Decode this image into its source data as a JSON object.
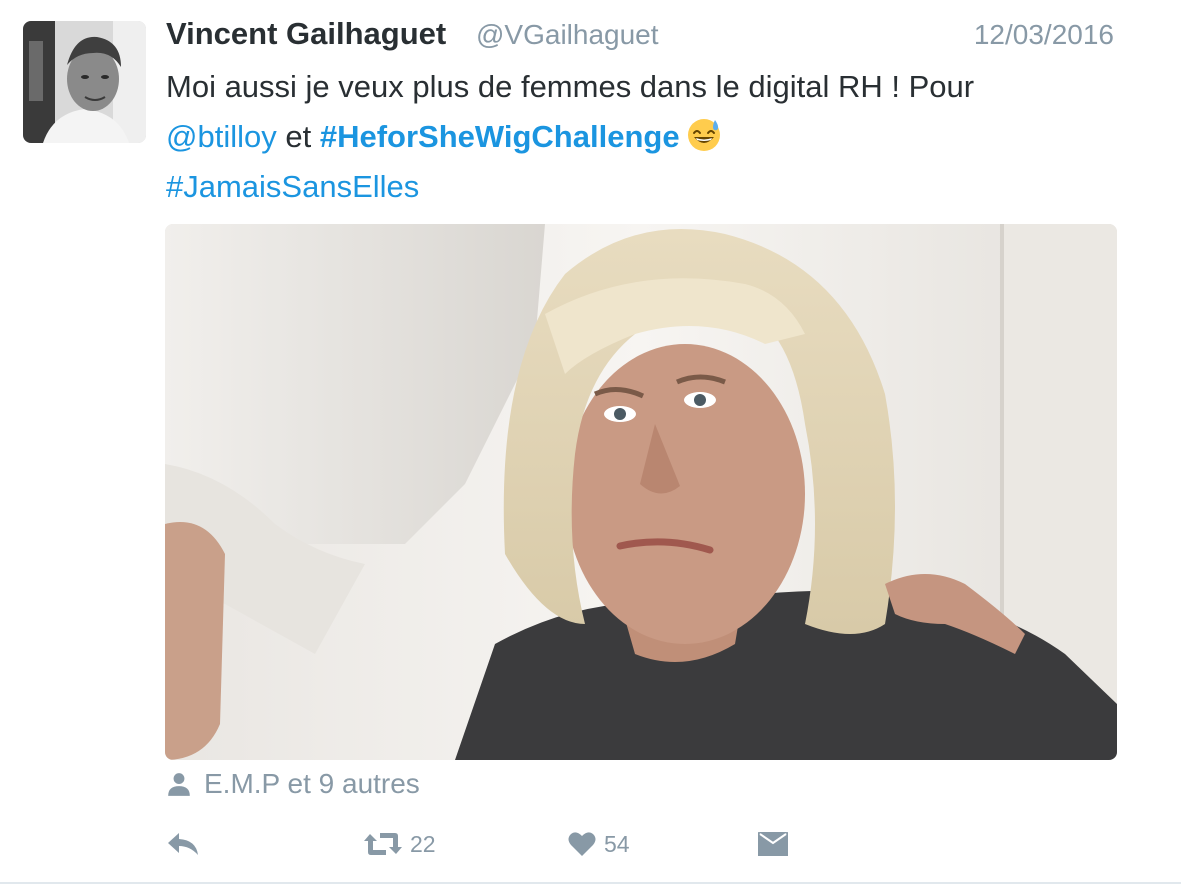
{
  "tweet": {
    "author": {
      "name": "Vincent Gailhaguet",
      "handle": "@VGailhaguet",
      "avatar_description": "avatar"
    },
    "date": "12/03/2016",
    "text": {
      "line1": "Moi aussi je veux plus de femmes dans le digital RH ! Pour",
      "mention": "@btilloy",
      "connector": "et",
      "hashtag1": "#HeforSheWigChallenge",
      "emoji": "grinning-sweat-emoji",
      "hashtag2": "#JamaisSansElles"
    },
    "likers_text": "E.M.P et 9 autres",
    "actions": {
      "reply": {
        "icon": "reply-icon"
      },
      "retweet": {
        "icon": "retweet-icon",
        "count": "22"
      },
      "like": {
        "icon": "heart-icon",
        "count": "54"
      },
      "message": {
        "icon": "envelope-icon"
      }
    }
  },
  "colors": {
    "link": "#1b95e0",
    "muted": "#8899a6",
    "text": "#292f33"
  }
}
